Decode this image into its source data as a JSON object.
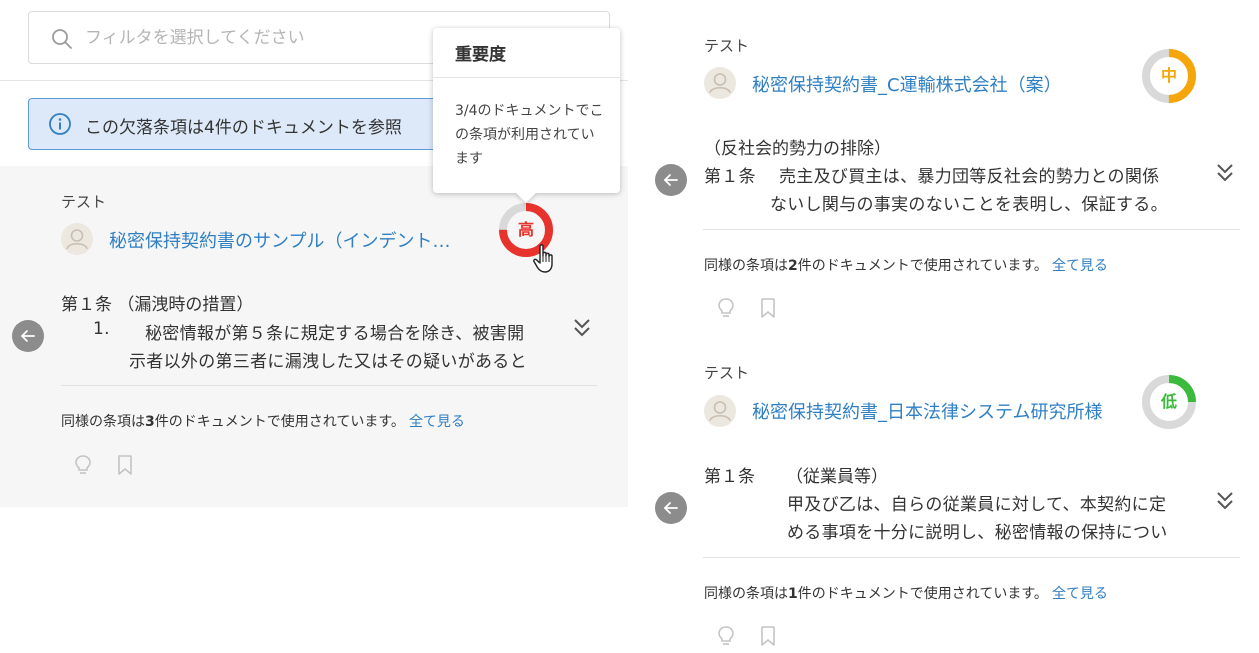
{
  "filter": {
    "placeholder": "フィルタを選択してください"
  },
  "banner": {
    "text": "この欠落条項は4件のドキュメントを参照"
  },
  "tooltip": {
    "title": "重要度",
    "body": "3/4のドキュメントでこの条項が利用されています"
  },
  "cards": [
    {
      "label": "テスト",
      "doc_title": "秘密保持契約書のサンプル（インデント…",
      "importance": {
        "label": "高",
        "fraction": 0.75,
        "color": "#e8322c"
      },
      "clause_title": "第１条 （漏洩時の措置）",
      "list_marker": "1.",
      "lines": [
        "秘密情報が第５条に規定する場合を除き、被害開",
        "示者以外の第三者に漏洩した又はその疑いがあると"
      ],
      "similar": {
        "prefix": "同様の条項は",
        "count": "3",
        "suffix": "件のドキュメントで使用されています。",
        "see_all": "全て見る"
      }
    },
    {
      "label": "テスト",
      "doc_title": "秘密保持契約書_C運輸株式会社（案）",
      "importance": {
        "label": "中",
        "fraction": 0.5,
        "color": "#f5a60a"
      },
      "clause_title": "（反社会的勢力の排除）",
      "clause_prefix": "第１条",
      "lines": [
        "売主及び買主は、暴力団等反社会的勢力との関係",
        "ないし関与の事実のないことを表明し、保証する。"
      ],
      "similar": {
        "prefix": "同様の条項は",
        "count": "2",
        "suffix": "件のドキュメントで使用されています。",
        "see_all": "全て見る"
      }
    },
    {
      "label": "テスト",
      "doc_title": "秘密保持契約書_日本法律システム研究所様",
      "importance": {
        "label": "低",
        "fraction": 0.25,
        "color": "#3cba3c"
      },
      "clause_title": "第１条",
      "clause_sub": "（従業員等）",
      "lines": [
        "甲及び乙は、自らの従業員に対して、本契約に定",
        "める事項を十分に説明し、秘密情報の保持につい"
      ],
      "similar": {
        "prefix": "同様の条項は",
        "count": "1",
        "suffix": "件のドキュメントで使用されています。",
        "see_all": "全て見る"
      }
    }
  ],
  "colors": {
    "link": "#2f7fc4",
    "gauge_track": "#d9d9d9",
    "banner_bg": "#dde9f8",
    "banner_border": "#5a9be0"
  }
}
